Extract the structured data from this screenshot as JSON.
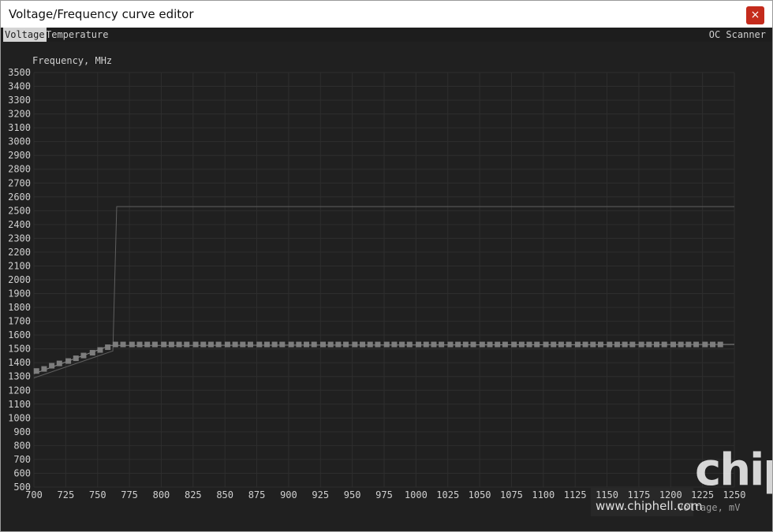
{
  "window": {
    "title": "Voltage/Frequency curve editor",
    "close_label": "×"
  },
  "tabs": [
    {
      "label": "Voltage",
      "active": true
    },
    {
      "label": "Temperature",
      "active": false
    }
  ],
  "oc_scanner_label": "OC Scanner",
  "watermark": {
    "logo": "chip",
    "url": "www.chiphell.com"
  },
  "colors": {
    "background": "#202020",
    "grid": "#2e2e2e",
    "curve": "#8c8c8c",
    "points": "#7d7d7d",
    "text": "#cfcfcf"
  },
  "chart_data": {
    "type": "line",
    "ylabel": "Frequency, MHz",
    "xlabel": "Voltage, mV",
    "xlim": [
      700,
      1250
    ],
    "ylim": [
      500,
      3500
    ],
    "xticks": [
      700,
      725,
      750,
      775,
      800,
      825,
      850,
      875,
      900,
      925,
      950,
      975,
      1000,
      1025,
      1050,
      1075,
      1100,
      1125,
      1150,
      1175,
      1200,
      1225,
      1250
    ],
    "yticks": [
      500,
      600,
      700,
      800,
      900,
      1000,
      1100,
      1200,
      1300,
      1400,
      1500,
      1600,
      1700,
      1800,
      1900,
      2000,
      2100,
      2200,
      2300,
      2400,
      2500,
      2600,
      2700,
      2800,
      2900,
      3000,
      3100,
      3200,
      3300,
      3400,
      3500
    ],
    "grid": true,
    "series": [
      {
        "values_x": [
          700,
          762,
          765,
          1250
        ],
        "values_y": [
          1290,
          1485,
          2530,
          2530
        ]
      },
      {
        "values_x": [
          700,
          760,
          1250
        ],
        "values_y": [
          1320,
          1525,
          1532
        ]
      },
      {
        "values_x": [
          702,
          708,
          714,
          720,
          727,
          733,
          739,
          746,
          752,
          758,
          764,
          770,
          777,
          783,
          789,
          795,
          802,
          808,
          814,
          820,
          827,
          833,
          839,
          845,
          852,
          858,
          864,
          870,
          877,
          883,
          889,
          895,
          902,
          908,
          914,
          920,
          927,
          933,
          939,
          945,
          952,
          958,
          964,
          970,
          977,
          983,
          989,
          995,
          1002,
          1008,
          1014,
          1020,
          1027,
          1033,
          1039,
          1045,
          1052,
          1058,
          1064,
          1070,
          1077,
          1083,
          1089,
          1095,
          1102,
          1108,
          1114,
          1120,
          1127,
          1133,
          1139,
          1145,
          1152,
          1158,
          1164,
          1170,
          1177,
          1183,
          1189,
          1195,
          1202,
          1208,
          1214,
          1220,
          1227,
          1233,
          1239
        ],
        "values_y": [
          1340,
          1355,
          1378,
          1395,
          1412,
          1432,
          1452,
          1472,
          1492,
          1512,
          1532,
          1532,
          1532,
          1532,
          1532,
          1532,
          1532,
          1532,
          1532,
          1532,
          1532,
          1532,
          1532,
          1532,
          1532,
          1532,
          1532,
          1532,
          1532,
          1532,
          1532,
          1532,
          1532,
          1532,
          1532,
          1532,
          1532,
          1532,
          1532,
          1532,
          1532,
          1532,
          1532,
          1532,
          1532,
          1532,
          1532,
          1532,
          1532,
          1532,
          1532,
          1532,
          1532,
          1532,
          1532,
          1532,
          1532,
          1532,
          1532,
          1532,
          1532,
          1532,
          1532,
          1532,
          1532,
          1532,
          1532,
          1532,
          1532,
          1532,
          1532,
          1532,
          1532,
          1532,
          1532,
          1532,
          1532,
          1532,
          1532,
          1532,
          1532,
          1532,
          1532,
          1532,
          1532,
          1532,
          1532
        ]
      }
    ]
  }
}
